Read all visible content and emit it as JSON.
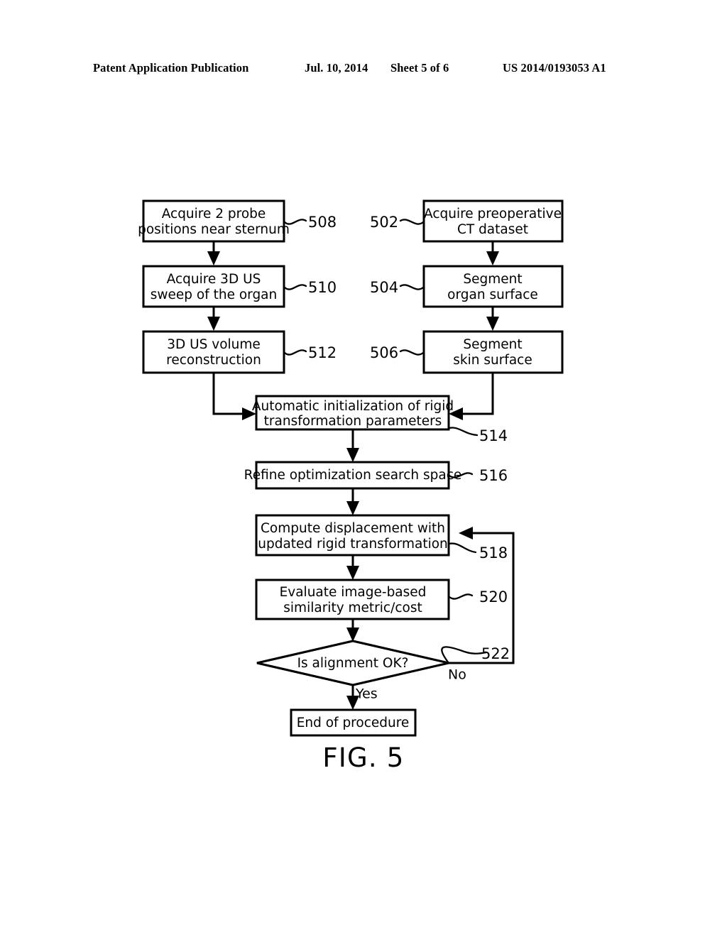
{
  "header": {
    "publication": "Patent Application Publication",
    "date": "Jul. 10, 2014",
    "sheet": "Sheet 5 of 6",
    "patent_number": "US 2014/0193053 A1"
  },
  "figure": {
    "caption": "FIG. 5",
    "boxes": {
      "b502": {
        "ref": "502",
        "line1": "Acquire preoperative",
        "line2": "CT dataset"
      },
      "b504": {
        "ref": "504",
        "line1": "Segment",
        "line2": "organ surface"
      },
      "b506": {
        "ref": "506",
        "line1": "Segment",
        "line2": "skin surface"
      },
      "b508": {
        "ref": "508",
        "line1": "Acquire 2 probe",
        "line2": "positions near sternum"
      },
      "b510": {
        "ref": "510",
        "line1": "Acquire 3D US",
        "line2": "sweep of the organ"
      },
      "b512": {
        "ref": "512",
        "line1": "3D US volume",
        "line2": "reconstruction"
      },
      "b514": {
        "ref": "514",
        "line1": "Automatic initialization of rigid",
        "line2": "transformation parameters"
      },
      "b516": {
        "ref": "516",
        "line1": "Refine optimization search space",
        "line2": ""
      },
      "b518": {
        "ref": "518",
        "line1": "Compute displacement with",
        "line2": "updated rigid transformation"
      },
      "b520": {
        "ref": "520",
        "line1": "Evaluate image-based",
        "line2": "similarity metric/cost"
      },
      "b522": {
        "ref": "522",
        "line1": "Is alignment OK?",
        "line2": ""
      },
      "bend": {
        "ref": "",
        "line1": "End of procedure",
        "line2": ""
      }
    },
    "edge_labels": {
      "yes": "Yes",
      "no": "No"
    }
  }
}
